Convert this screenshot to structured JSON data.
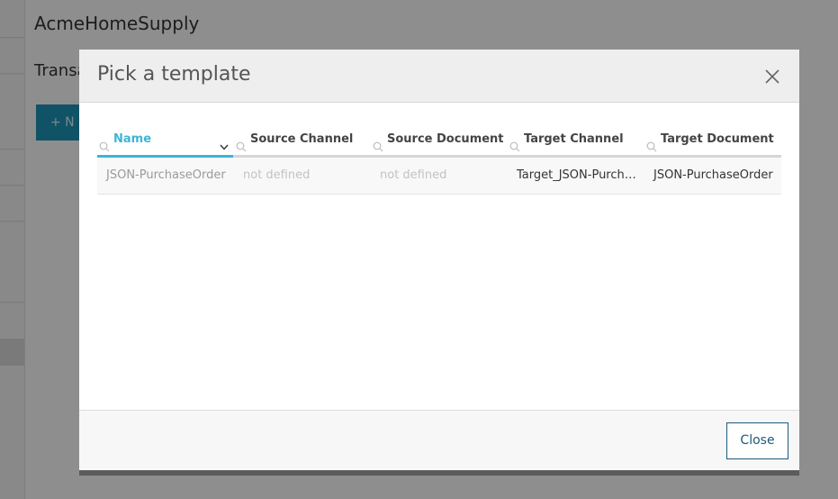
{
  "background": {
    "app_title": "AcmeHomeSupply",
    "section_title": "Transa",
    "new_button_label": "+ N"
  },
  "modal": {
    "title": "Pick a template",
    "close_icon": "close-icon",
    "columns": [
      {
        "label": "Name",
        "active": true,
        "sort": "descending"
      },
      {
        "label": "Source Channel"
      },
      {
        "label": "Source Document"
      },
      {
        "label": "Target Channel"
      },
      {
        "label": "Target Document"
      }
    ],
    "rows": [
      {
        "name": "JSON-PurchaseOrder",
        "source_channel": "not defined",
        "source_document": "not defined",
        "target_channel": "Target_JSON-PurchaseOrder",
        "target_document": "JSON-PurchaseOrder"
      }
    ],
    "footer": {
      "close_label": "Close"
    }
  },
  "colors": {
    "accent": "#3db4d8",
    "button_border": "#1d5a7a",
    "brand_button": "#1e8fb0"
  }
}
